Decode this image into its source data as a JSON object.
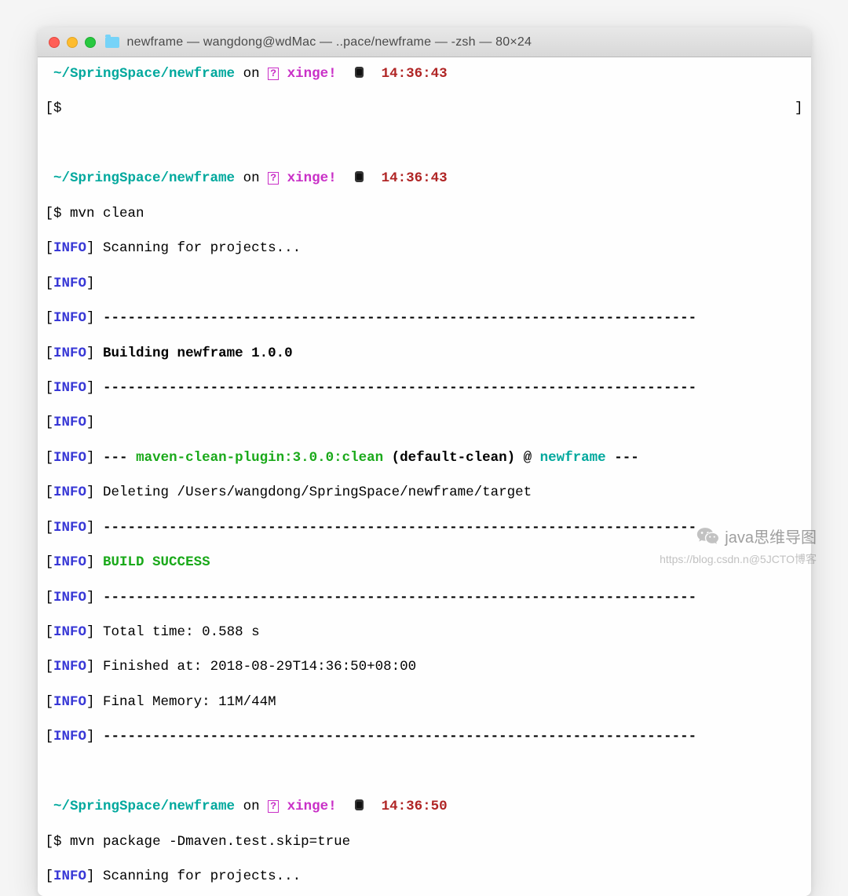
{
  "titlebar": {
    "title": "newframe — wangdong@wdMac — ..pace/newframe — -zsh — 80×24"
  },
  "prompts": [
    {
      "path": "~/SpringSpace/newframe",
      "word_on": "on",
      "branch": "xinge!",
      "time": "14:36:43",
      "cmd": ""
    },
    {
      "path": "~/SpringSpace/newframe",
      "word_on": "on",
      "branch": "xinge!",
      "time": "14:36:43",
      "cmd": "mvn clean"
    },
    {
      "path": "~/SpringSpace/newframe",
      "word_on": "on",
      "branch": "xinge!",
      "time": "14:36:50",
      "cmd": "mvn package -Dmaven.test.skip=true"
    }
  ],
  "info_label": "INFO",
  "lines": {
    "scan": "Scanning for projects...",
    "dash": "------------------------------------------------------------------------",
    "building": "Building newframe 1.0.0",
    "plugin_pre": "--- ",
    "plugin": "maven-clean-plugin:3.0.0:clean",
    "plugin_mid": " (default-clean) @ ",
    "plugin_proj": "newframe",
    "plugin_post": " ---",
    "deleting": "Deleting /Users/wangdong/SpringSpace/newframe/target",
    "build_success": "BUILD SUCCESS",
    "total_time": "Total time: 0.588 s",
    "finished": "Finished at: 2018-08-29T14:36:50+08:00",
    "memory": "Final Memory: 11M/44M"
  },
  "brackets": {
    "l": "[",
    "r": "]",
    "dollar": "$"
  },
  "watermark": {
    "text1": "java思维导图",
    "text2": "https://blog.csdn.n@5JCTO博客"
  }
}
